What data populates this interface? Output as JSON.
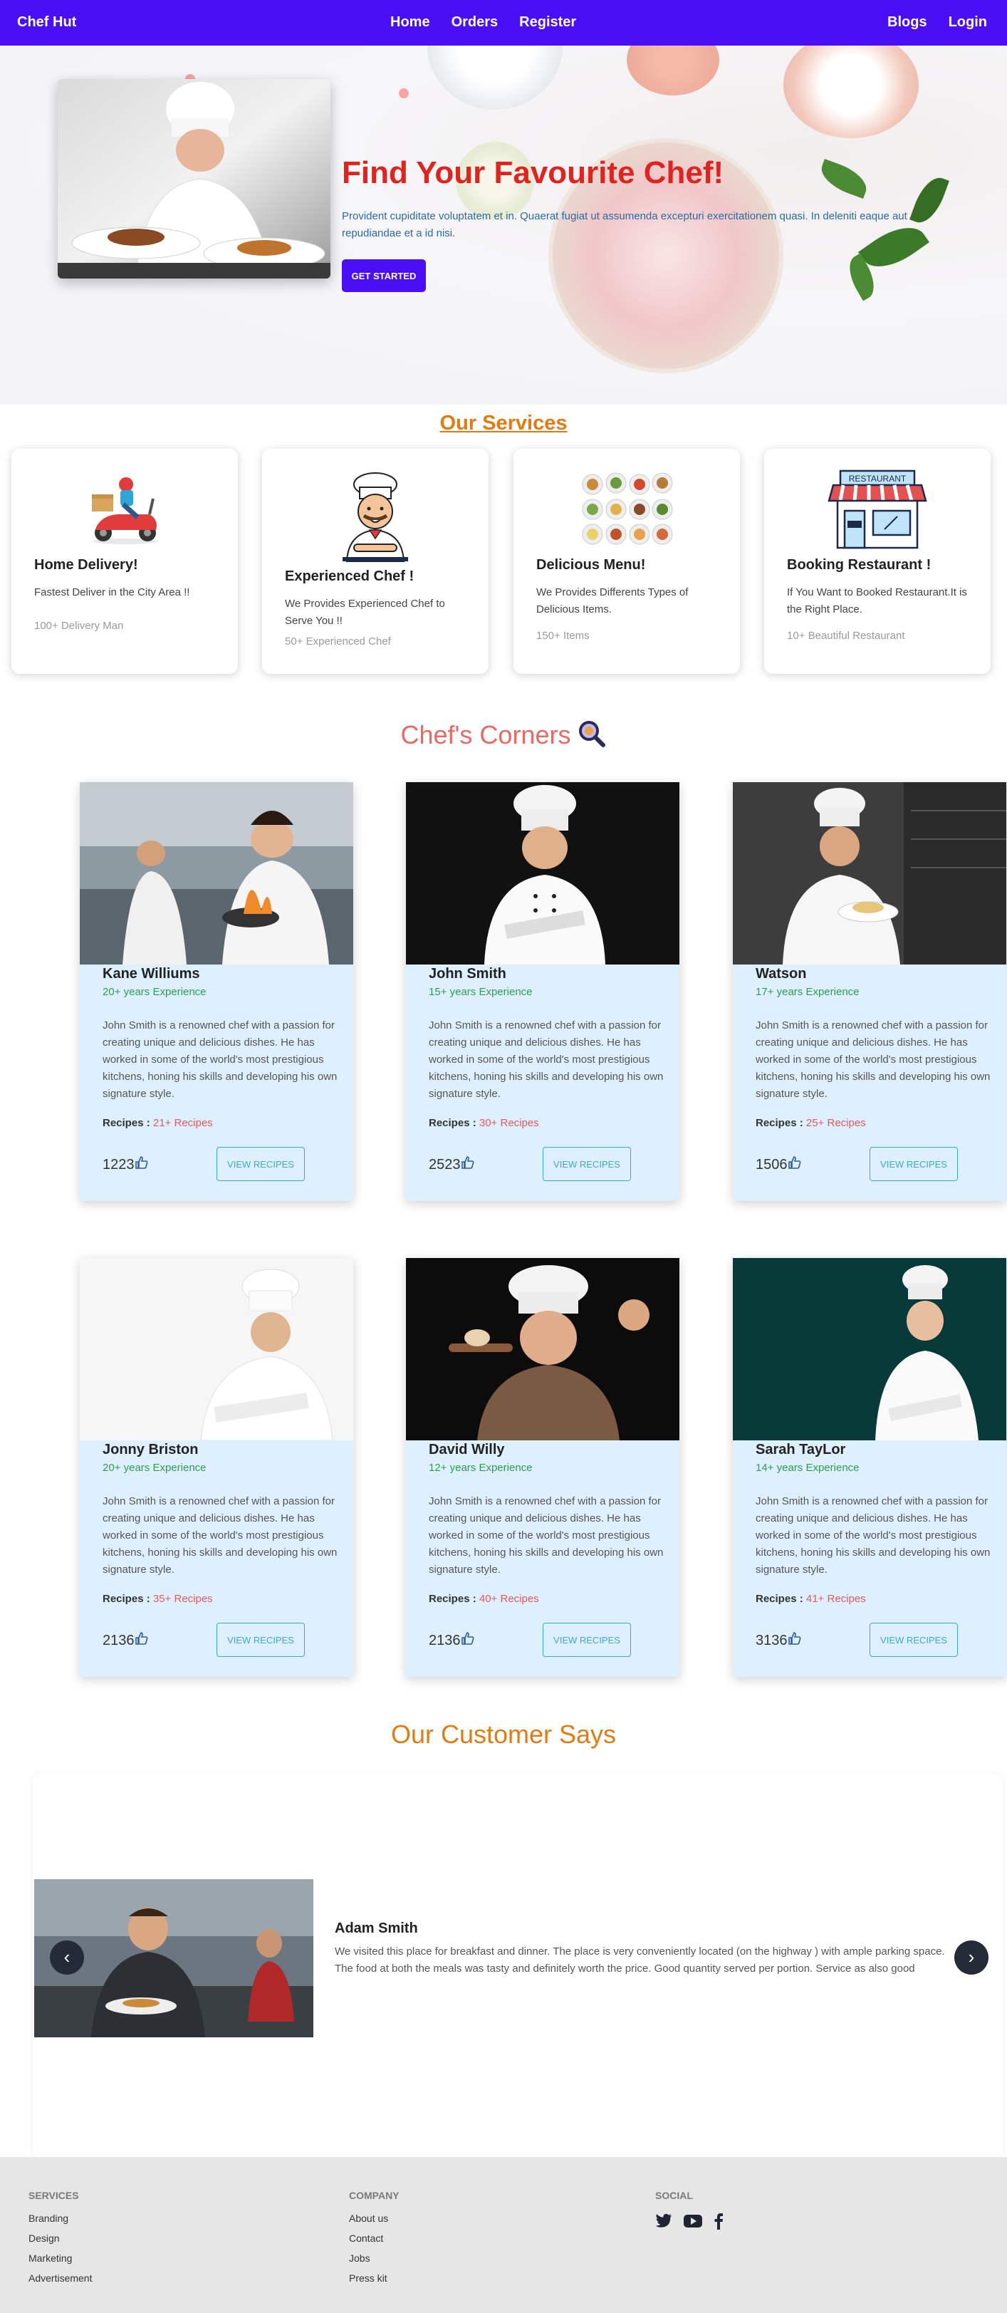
{
  "navbar": {
    "brand": "Chef Hut",
    "center": [
      "Home",
      "Orders",
      "Register"
    ],
    "right": [
      "Blogs",
      "Login"
    ]
  },
  "hero": {
    "title": "Find Your Favourite Chef!",
    "description": "Provident cupiditate voluptatem et in. Quaerat fugiat ut assumenda excepturi exercitationem quasi. In deleniti eaque aut repudiandae et a id nisi.",
    "button": "GET STARTED"
  },
  "services": {
    "title": "Our Services",
    "items": [
      {
        "title": "Home Delivery!",
        "desc": "Fastest Deliver in the City Area !!",
        "stat": "100+ Delivery Man",
        "icon": "delivery-scooter-icon"
      },
      {
        "title": "Experienced Chef !",
        "desc": "We Provides Experienced Chef to Serve You !!",
        "stat": "50+ Experienced Chef",
        "icon": "chef-mascot-icon"
      },
      {
        "title": "Delicious Menu!",
        "desc": "We Provides Differents Types of Delicious Items.",
        "stat": "150+ Items",
        "icon": "food-platter-icon"
      },
      {
        "title": "Booking Restaurant !",
        "desc": "If You Want to Booked Restaurant.It is the Right Place.",
        "stat": "10+ Beautiful Restaurant",
        "icon": "restaurant-storefront-icon",
        "sign": "RESTAURANT"
      }
    ]
  },
  "chefs": {
    "title": "Chef's Corners",
    "bio": "John Smith is a renowned chef with a passion for creating unique and delicious dishes. He has worked in some of the world's most prestigious kitchens, honing his skills and developing his own signature style.",
    "recipes_label": "Recipes :",
    "view_button": "VIEW RECIPES",
    "items": [
      {
        "name": "Kane Williums",
        "exp": "20+ years Experience",
        "recipes": "21+ Recipes",
        "likes": "1223"
      },
      {
        "name": "John Smith",
        "exp": "15+ years Experience",
        "recipes": "30+ Recipes",
        "likes": "2523"
      },
      {
        "name": "Watson",
        "exp": "17+ years Experience",
        "recipes": "25+ Recipes",
        "likes": "1506"
      },
      {
        "name": "Jonny Briston",
        "exp": "20+ years Experience",
        "recipes": "35+ Recipes",
        "likes": "2136"
      },
      {
        "name": "David Willy",
        "exp": "12+ years Experience",
        "recipes": "40+ Recipes",
        "likes": "2136"
      },
      {
        "name": "Sarah TayLor",
        "exp": "14+ years Experience",
        "recipes": "41+ Recipes",
        "likes": "3136"
      }
    ]
  },
  "testimonials": {
    "title": "Our Customer Says",
    "name": "Adam Smith",
    "text": "We visited this place for breakfast and dinner. The place is very conveniently located (on the highway ) with ample parking space. The food at both the meals was tasty and definitely worth the price. Good quantity served per portion. Service as also good",
    "prev": "‹",
    "next": "›"
  },
  "footer": {
    "services": {
      "title": "SERVICES",
      "links": [
        "Branding",
        "Design",
        "Marketing",
        "Advertisement"
      ]
    },
    "company": {
      "title": "COMPANY",
      "links": [
        "About us",
        "Contact",
        "Jobs",
        "Press kit"
      ]
    },
    "social": {
      "title": "SOCIAL",
      "icons": [
        "twitter-icon",
        "youtube-icon",
        "facebook-icon"
      ]
    }
  },
  "colors": {
    "primary": "#4b0ff5",
    "hero_title": "#e0231f",
    "section_orange": "#e07c12",
    "chef_title": "#e86a62",
    "card_bg": "#def0fe",
    "experience_green": "#2e9d4d",
    "recipes_red": "#e45a5a",
    "button_outline": "#3ba9cc"
  }
}
